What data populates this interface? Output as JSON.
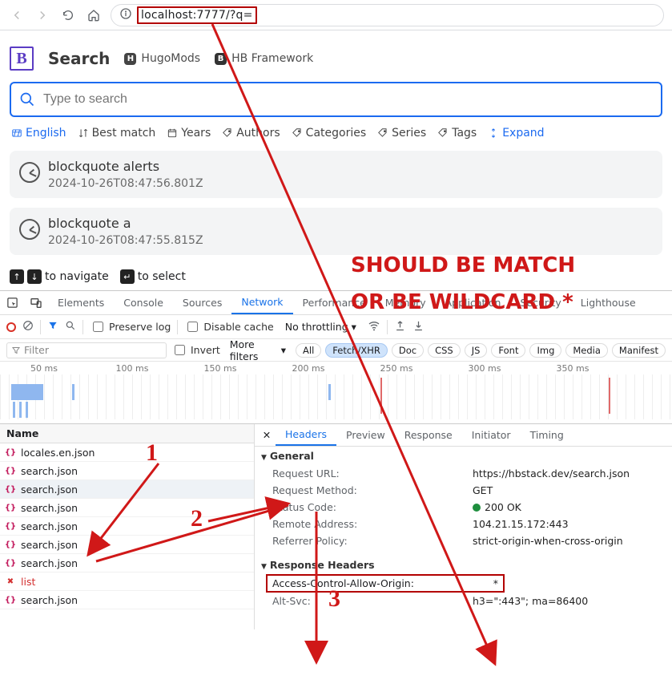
{
  "browser": {
    "url": "localhost:7777/?q="
  },
  "brand": {
    "title": "Search",
    "link1": "HugoMods",
    "link2": "HB Framework"
  },
  "search": {
    "placeholder": "Type to search"
  },
  "filters": {
    "language": "English",
    "sort": "Best match",
    "years": "Years",
    "authors": "Authors",
    "categories": "Categories",
    "series": "Series",
    "tags": "Tags",
    "expand": "Expand"
  },
  "results": [
    {
      "title": "blockquote alerts",
      "time": "2024-10-26T08:47:56.801Z"
    },
    {
      "title": "blockquote a",
      "time": "2024-10-26T08:47:55.815Z"
    }
  ],
  "kbhints": {
    "navigate": "to navigate",
    "select": "to select"
  },
  "devtools": {
    "tabs": [
      "Elements",
      "Console",
      "Sources",
      "Network",
      "Performance",
      "Memory",
      "Application",
      "Security",
      "Lighthouse"
    ],
    "activeTab": "Network",
    "preserve": "Preserve log",
    "disableCache": "Disable cache",
    "throttling": "No throttling",
    "filterPlaceholder": "Filter",
    "invert": "Invert",
    "moreFilters": "More filters",
    "chips": [
      "All",
      "Fetch/XHR",
      "Doc",
      "CSS",
      "JS",
      "Font",
      "Img",
      "Media",
      "Manifest"
    ],
    "activeChip": "Fetch/XHR",
    "timelineTicks": [
      "50 ms",
      "100 ms",
      "150 ms",
      "200 ms",
      "250 ms",
      "300 ms",
      "350 ms"
    ],
    "nameHeader": "Name",
    "requests": [
      {
        "name": "locales.en.json",
        "icon": "json"
      },
      {
        "name": "search.json",
        "icon": "json"
      },
      {
        "name": "search.json",
        "icon": "json",
        "selected": true
      },
      {
        "name": "search.json",
        "icon": "json"
      },
      {
        "name": "search.json",
        "icon": "json"
      },
      {
        "name": "search.json",
        "icon": "json"
      },
      {
        "name": "search.json",
        "icon": "json"
      },
      {
        "name": "list",
        "icon": "err"
      },
      {
        "name": "search.json",
        "icon": "json"
      }
    ],
    "rightTabs": [
      "Headers",
      "Preview",
      "Response",
      "Initiator",
      "Timing"
    ],
    "activeRightTab": "Headers",
    "sections": {
      "general": "General",
      "responseHeaders": "Response Headers"
    },
    "general": {
      "requestUrl": {
        "k": "Request URL:",
        "v": "https://hbstack.dev/search.json"
      },
      "requestMethod": {
        "k": "Request Method:",
        "v": "GET"
      },
      "statusCode": {
        "k": "Status Code:",
        "v": "200 OK"
      },
      "remoteAddress": {
        "k": "Remote Address:",
        "v": "104.21.15.172:443"
      },
      "referrerPolicy": {
        "k": "Referrer Policy:",
        "v": "strict-origin-when-cross-origin"
      }
    },
    "responseHeaders": {
      "acao": {
        "k": "Access-Control-Allow-Origin:",
        "v": "*"
      },
      "altSvc": {
        "k": "Alt-Svc:",
        "v": "h3=\":443\"; ma=86400"
      }
    }
  },
  "annotations": {
    "big1": "SHOULD BE MATCH",
    "big2": "OR BE WILDCARD *",
    "n1": "1",
    "n2": "2",
    "n3": "3"
  }
}
